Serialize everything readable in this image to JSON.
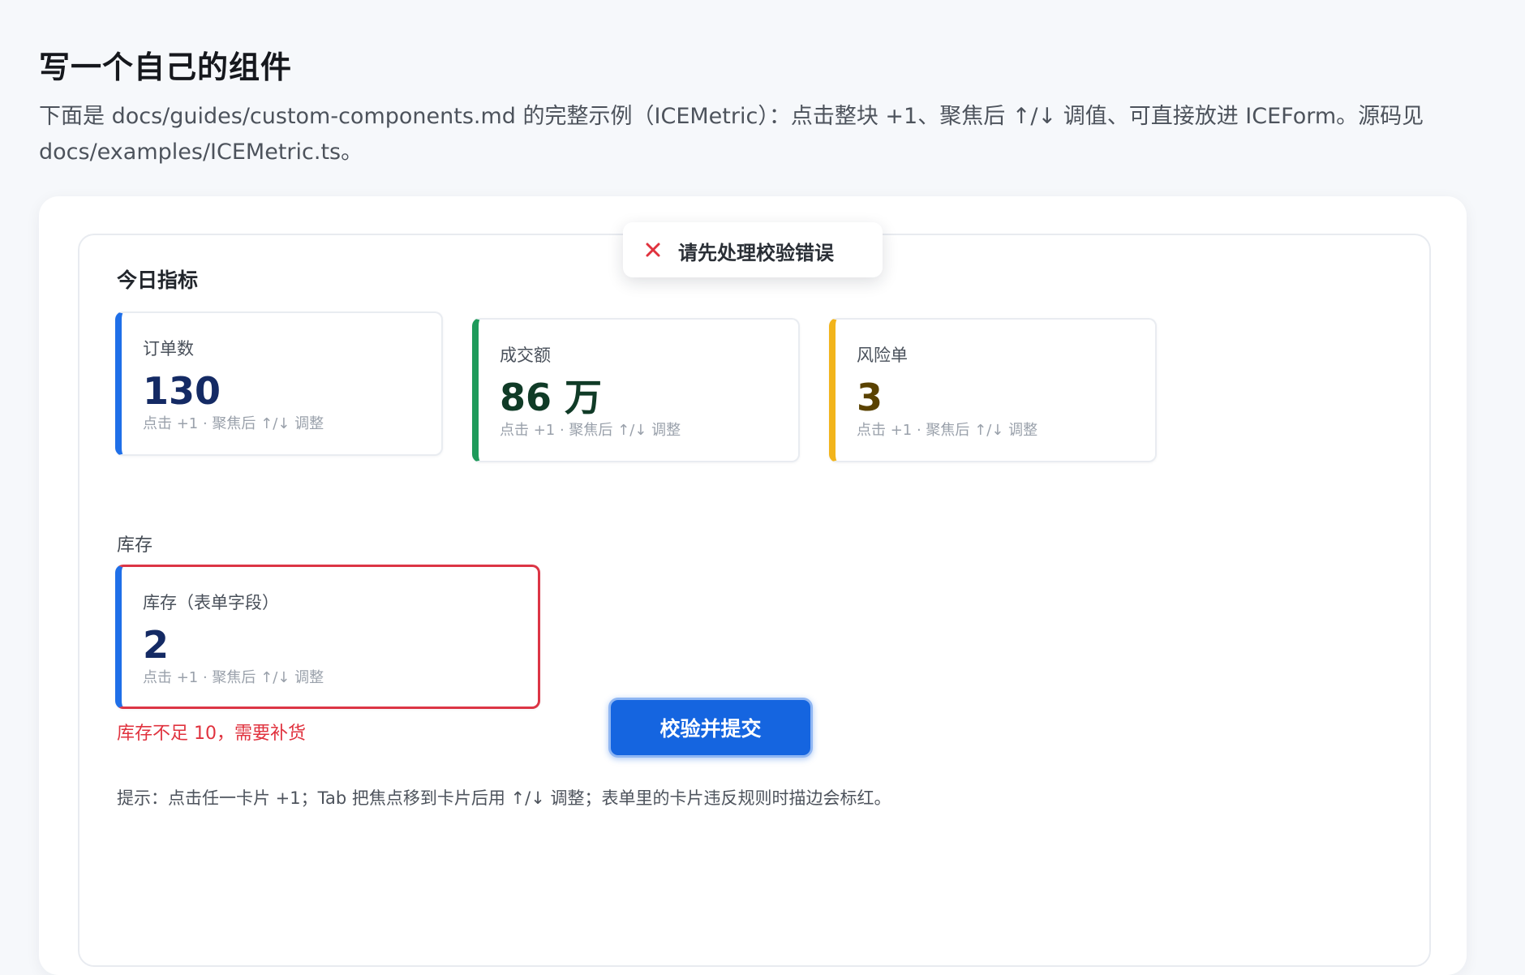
{
  "page": {
    "title": "写一个自己的组件",
    "description": "下面是 docs/guides/custom-components.md 的完整示例（ICEMetric）：点击整块 +1、聚焦后 ↑/↓ 调值、可直接放进 ICEForm。源码见 docs/examples/ICEMetric.ts。"
  },
  "toast": {
    "icon": "close-icon",
    "message": "请先处理校验错误",
    "icon_color": "#e0323e"
  },
  "metrics_section": {
    "title": "今日指标",
    "cards": [
      {
        "label": "订单数",
        "value": "130",
        "hint": "点击 +1 · 聚焦后 ↑/↓ 调整",
        "accent": "#1f6fe8"
      },
      {
        "label": "成交额",
        "value": "86 万",
        "hint": "点击 +1 · 聚焦后 ↑/↓ 调整",
        "accent": "#1e9a5a"
      },
      {
        "label": "风险单",
        "value": "3",
        "hint": "点击 +1 · 聚焦后 ↑/↓ 调整",
        "accent": "#f2b41b"
      }
    ]
  },
  "stock_section": {
    "title": "库存",
    "card": {
      "label": "库存（表单字段）",
      "value": "2",
      "hint": "点击 +1 · 聚焦后 ↑/↓ 调整",
      "accent": "#1f6fe8",
      "error_border": "#dc3545"
    },
    "error": "库存不足 10，需要补货"
  },
  "submit_label": "校验并提交",
  "tip": "提示：点击任一卡片 +1；Tab 把焦点移到卡片后用 ↑/↓ 调整；表单里的卡片违反规则时描边会标红。",
  "colors": {
    "primary": "#1565e0",
    "error": "#e0323e"
  }
}
